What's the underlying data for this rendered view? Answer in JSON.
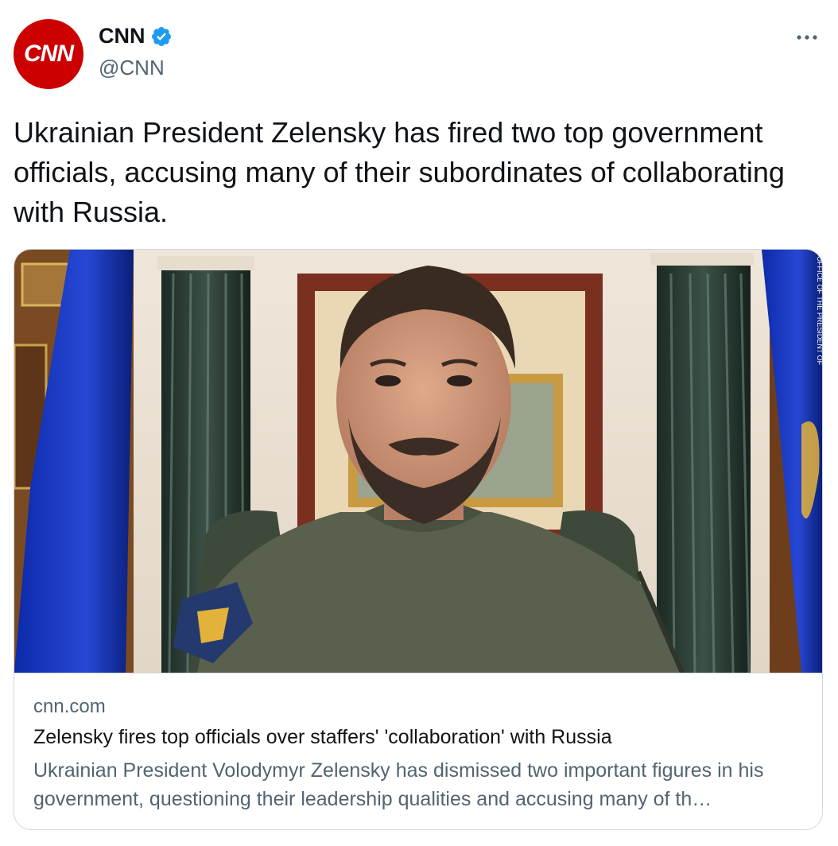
{
  "author": {
    "name": "CNN",
    "handle": "@CNN",
    "avatar_text": "CNN",
    "verified": true
  },
  "tweet": {
    "text": "Ukrainian President Zelensky has fired two top government officials, accusing many of their subordinates of collaborating with Russia."
  },
  "card": {
    "domain": "cnn.com",
    "title": "Zelensky fires top officials over staffers' 'collaboration' with Russia",
    "description": "Ukrainian President Volodymyr Zelensky has dismissed two important figures in his government, questioning their leadership qualities and accusing many of th…",
    "image_credit": "OFFICE OF THE PRESIDENT OF"
  },
  "colors": {
    "brand": "#cc0000",
    "verified": "#1d9bf0",
    "secondary_text": "#536471",
    "border": "#cfd9de"
  }
}
